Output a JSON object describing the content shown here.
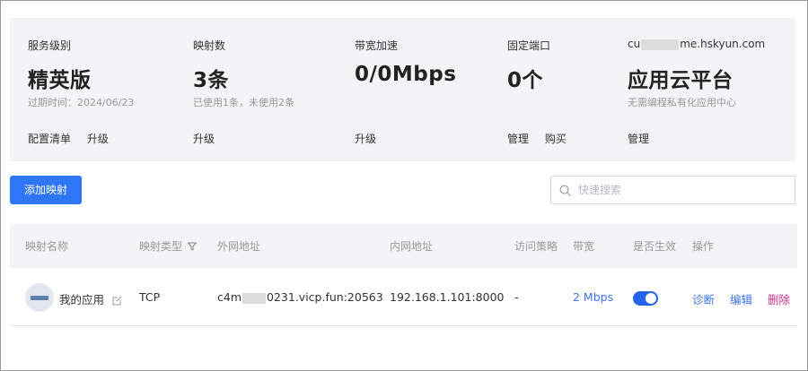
{
  "summary": {
    "service_level": {
      "label": "服务级别",
      "value": "精英版",
      "sub": "过期时间：2024/06/23",
      "actions": [
        "配置清单",
        "升级"
      ]
    },
    "mappings": {
      "label": "映射数",
      "value": "3条",
      "sub": "已使用1条，未使用2条",
      "actions": [
        "升级"
      ]
    },
    "bandwidth": {
      "label": "带宽加速",
      "value": "0/0Mbps",
      "sub": "",
      "actions": [
        "升级"
      ]
    },
    "fixed_port": {
      "label": "固定端口",
      "value": "0个",
      "sub": "",
      "actions": [
        "管理",
        "购买"
      ]
    },
    "account": {
      "label_prefix": "cu",
      "label_suffix": "me.hskyun.com",
      "value": "应用云平台",
      "sub": "无需编程私有化应用中心",
      "actions": [
        "管理"
      ]
    }
  },
  "toolbar": {
    "add_label": "添加映射",
    "search_placeholder": "快速搜索"
  },
  "table": {
    "headers": {
      "name": "映射名称",
      "type": "映射类型",
      "external": "外网地址",
      "internal": "内网地址",
      "policy": "访问策略",
      "bandwidth": "带宽",
      "enabled": "是否生效",
      "ops": "操作"
    },
    "rows": [
      {
        "name": "我的应用",
        "type": "TCP",
        "external_prefix": "c4m",
        "external_suffix": "0231.vicp.fun:20563",
        "internal": "192.168.1.101:8000",
        "policy": "-",
        "bandwidth": "2 Mbps",
        "enabled": true,
        "ops": {
          "diagnose": "诊断",
          "edit": "编辑",
          "delete": "删除"
        }
      }
    ]
  },
  "colors": {
    "primary": "#2f76f6",
    "link": "#3b74f2",
    "danger": "#cf2e8a",
    "panel_bg": "#f3f4f6"
  },
  "icons": {
    "search": "search-icon",
    "filter": "filter-icon",
    "edit": "edit-icon",
    "app": "app-icon"
  }
}
